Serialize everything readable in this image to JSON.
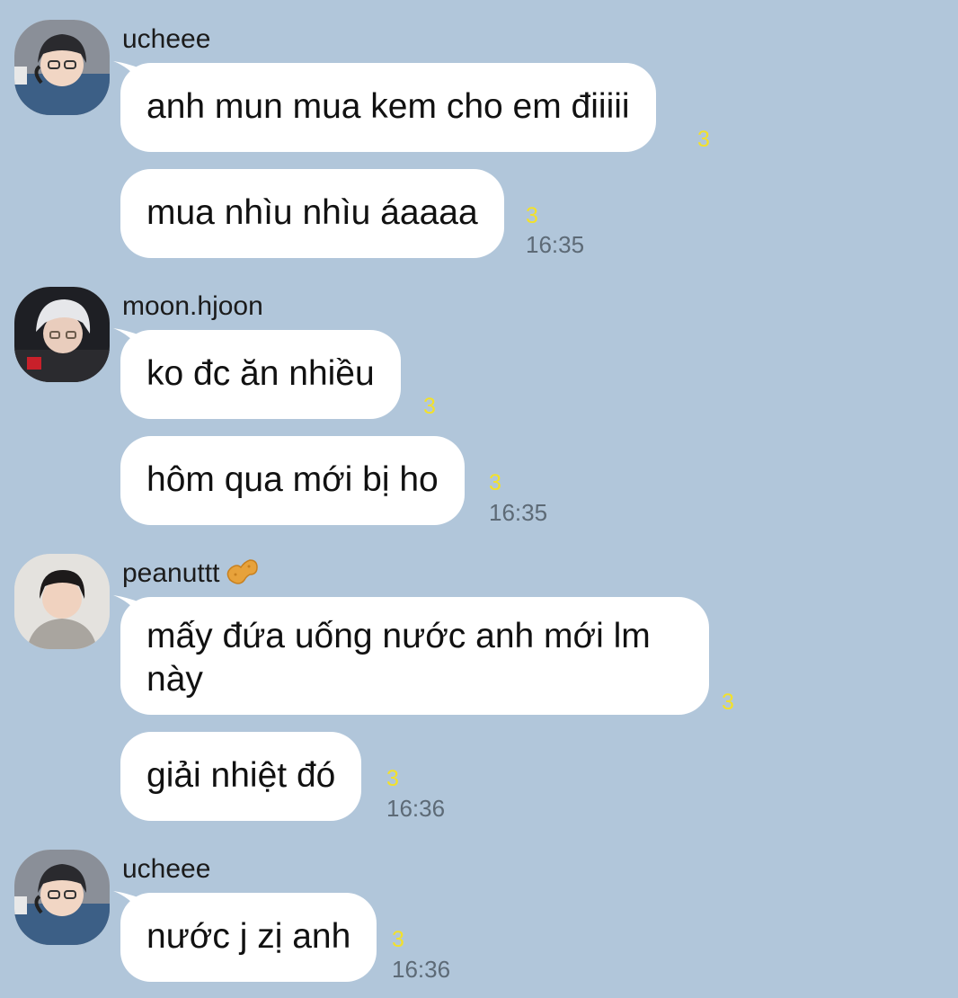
{
  "messages": [
    {
      "sender": "ucheee",
      "avatar_icon": "user-avatar-ucheee",
      "bubbles": [
        {
          "text": "anh mun mua kem cho em điiiii",
          "unread": "3"
        },
        {
          "text": "mua nhìu nhìu áaaaa",
          "unread": "3",
          "time": "16:35"
        }
      ]
    },
    {
      "sender": "moon.hjoon",
      "avatar_icon": "user-avatar-moon-hjoon",
      "bubbles": [
        {
          "text": "ko đc ăn nhiều",
          "unread": "3"
        },
        {
          "text": "hôm qua mới bị ho",
          "unread": "3",
          "time": "16:35"
        }
      ]
    },
    {
      "sender": "peanuttt",
      "sender_emoji": "peanut-icon",
      "avatar_icon": "user-avatar-peanuttt",
      "bubbles": [
        {
          "text": "mấy đứa uống nước anh mới lm này",
          "unread": "3"
        },
        {
          "text": "giải nhiệt đó",
          "unread": "3",
          "time": "16:36"
        }
      ]
    },
    {
      "sender": "ucheee",
      "avatar_icon": "user-avatar-ucheee",
      "bubbles": [
        {
          "text": "nước j zị anh",
          "unread": "3",
          "time": "16:36"
        }
      ]
    }
  ],
  "colors": {
    "background": "#b1c6da",
    "bubble": "#ffffff",
    "unread": "#f3e12a",
    "time": "#5d6a76"
  }
}
